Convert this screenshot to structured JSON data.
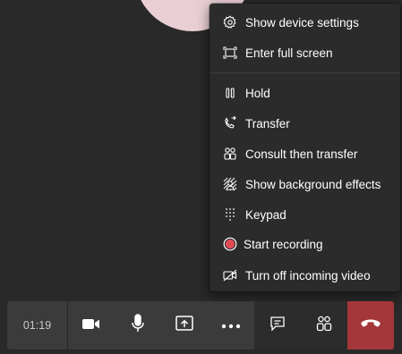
{
  "menu": {
    "items": [
      {
        "label": "Show device settings",
        "icon": "gear-icon"
      },
      {
        "label": "Enter full screen",
        "icon": "fullscreen-icon"
      },
      {
        "label": "Hold",
        "icon": "pause-icon"
      },
      {
        "label": "Transfer",
        "icon": "phone-transfer-icon"
      },
      {
        "label": "Consult then transfer",
        "icon": "people-icon"
      },
      {
        "label": "Show background effects",
        "icon": "background-effects-icon"
      },
      {
        "label": "Keypad",
        "icon": "dialpad-icon"
      },
      {
        "label": "Start recording",
        "icon": "record-icon"
      },
      {
        "label": "Turn off incoming video",
        "icon": "video-off-icon"
      }
    ]
  },
  "callbar": {
    "timer": "01:19",
    "buttons": [
      {
        "name": "camera",
        "icon": "video-camera-icon"
      },
      {
        "name": "microphone",
        "icon": "microphone-icon"
      },
      {
        "name": "share",
        "icon": "share-screen-icon"
      },
      {
        "name": "more",
        "icon": "more-options-icon"
      },
      {
        "name": "chat",
        "icon": "chat-icon"
      },
      {
        "name": "participants",
        "icon": "participants-icon"
      },
      {
        "name": "hang-up",
        "icon": "hang-up-icon"
      }
    ]
  },
  "colors": {
    "background": "#292929",
    "menu_background": "#2b2b2b",
    "button_background": "#3b3b3b",
    "hangup": "#a4373a",
    "record_dot": "#e04a55",
    "avatar": "#e9cfd3"
  }
}
